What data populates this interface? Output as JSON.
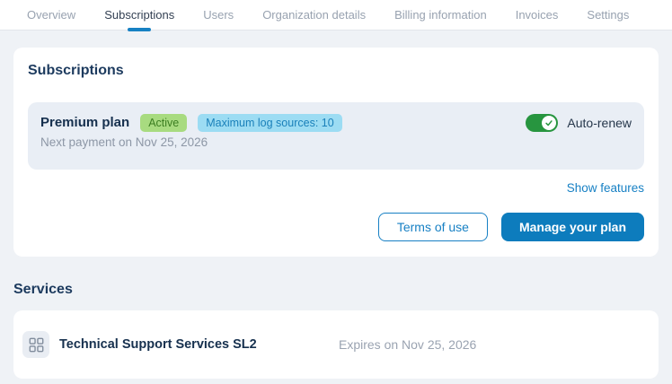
{
  "tabs": {
    "items": [
      {
        "label": "Overview",
        "active": false
      },
      {
        "label": "Subscriptions",
        "active": true
      },
      {
        "label": "Users",
        "active": false
      },
      {
        "label": "Organization details",
        "active": false
      },
      {
        "label": "Billing information",
        "active": false
      },
      {
        "label": "Invoices",
        "active": false
      },
      {
        "label": "Settings",
        "active": false
      }
    ]
  },
  "subscriptions_section": {
    "title": "Subscriptions",
    "plan": {
      "name": "Premium plan",
      "status_badge": "Active",
      "log_sources_badge": "Maximum log sources: 10",
      "next_payment": "Next payment on Nov 25, 2026",
      "auto_renew_label": "Auto-renew",
      "auto_renew_on": true
    },
    "show_features_label": "Show features",
    "terms_button_label": "Terms of use",
    "manage_button_label": "Manage your plan"
  },
  "services_section": {
    "title": "Services",
    "items": [
      {
        "name": "Technical Support Services SL2",
        "expires": "Expires on Nov 25, 2026"
      }
    ]
  },
  "colors": {
    "accent_blue": "#1781C3",
    "primary_button": "#0D7CBD",
    "toggle_green": "#27953F",
    "badge_green_bg": "#A8DB80",
    "badge_green_text": "#3C7E21",
    "badge_blue_bg": "#9CDCF3",
    "badge_blue_text": "#1A80BA",
    "page_background": "#EFF2F6",
    "panel_background": "#E9EEF5"
  }
}
